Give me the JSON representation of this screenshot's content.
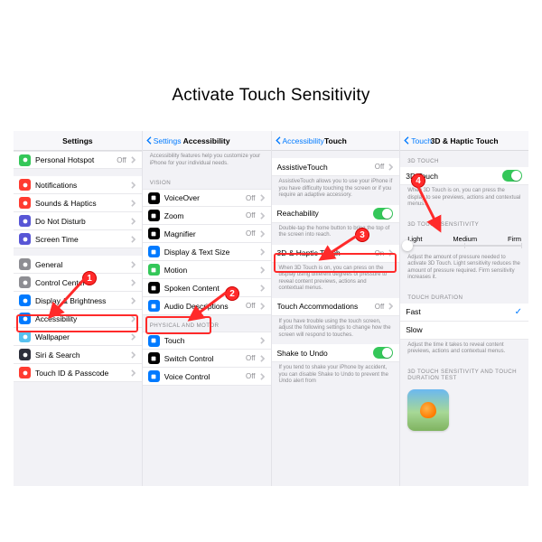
{
  "title": "Activate Touch Sensitivity",
  "panel1": {
    "header": "Settings",
    "rows": [
      {
        "label": "Personal Hotspot",
        "val": "Off",
        "iconColor": "#34c759"
      },
      {
        "label": "Notifications",
        "iconColor": "#ff3b30"
      },
      {
        "label": "Sounds & Haptics",
        "iconColor": "#ff3b30"
      },
      {
        "label": "Do Not Disturb",
        "iconColor": "#5856d6"
      },
      {
        "label": "Screen Time",
        "iconColor": "#5856d6"
      },
      {
        "label": "General",
        "iconColor": "#8e8e93"
      },
      {
        "label": "Control Center",
        "iconColor": "#8e8e93"
      },
      {
        "label": "Display & Brightness",
        "iconColor": "#007aff"
      },
      {
        "label": "Accessibility",
        "iconColor": "#007aff"
      },
      {
        "label": "Wallpaper",
        "iconColor": "#57c1ef"
      },
      {
        "label": "Siri & Search",
        "iconColor": "#2d2f3b"
      },
      {
        "label": "Touch ID & Passcode",
        "iconColor": "#ff3b30"
      }
    ]
  },
  "panel2": {
    "back": "Settings",
    "header": "Accessibility",
    "desc": "Accessibility features help you customize your iPhone for your individual needs.",
    "sect1": "VISION",
    "vision": [
      {
        "label": "VoiceOver",
        "val": "Off",
        "iconColor": "#000"
      },
      {
        "label": "Zoom",
        "val": "Off",
        "iconColor": "#000"
      },
      {
        "label": "Magnifier",
        "val": "Off",
        "iconColor": "#000"
      },
      {
        "label": "Display & Text Size",
        "iconColor": "#007aff"
      },
      {
        "label": "Motion",
        "iconColor": "#34c759"
      },
      {
        "label": "Spoken Content",
        "iconColor": "#000"
      },
      {
        "label": "Audio Descriptions",
        "val": "Off",
        "iconColor": "#007aff"
      }
    ],
    "sect2": "PHYSICAL AND MOTOR",
    "motor": [
      {
        "label": "Touch",
        "iconColor": "#007aff"
      },
      {
        "label": "Switch Control",
        "val": "Off",
        "iconColor": "#000"
      },
      {
        "label": "Voice Control",
        "val": "Off",
        "iconColor": "#007aff"
      }
    ]
  },
  "panel3": {
    "back": "Accessibility",
    "header": "Touch",
    "rows": [
      {
        "label": "AssistiveTouch",
        "val": "Off"
      }
    ],
    "desc1": "AssistiveTouch allows you to use your iPhone if you have difficulty touching the screen or if you require an adaptive accessory.",
    "reach": {
      "label": "Reachability"
    },
    "desc2": "Double-tap the home button to bring the top of the screen into reach.",
    "haptic": {
      "label": "3D & Haptic Touch",
      "val": "On"
    },
    "desc3": "When 3D Touch is on, you can press on the display using different degrees of pressure to reveal content previews, actions and contextual menus.",
    "accom": {
      "label": "Touch Accommodations",
      "val": "Off"
    },
    "desc4": "If you have trouble using the touch screen, adjust the following settings to change how the screen will respond to touches.",
    "shake": {
      "label": "Shake to Undo"
    },
    "desc5": "If you tend to shake your iPhone by accident, you can disable Shake to Undo to prevent the Undo alert from"
  },
  "panel4": {
    "back": "Touch",
    "header": "3D & Haptic Touch",
    "sect1": "3D TOUCH",
    "row1": {
      "label": "3D Touch"
    },
    "desc1": "When 3D Touch is on, you can press the display to see previews, actions and contextual menus.",
    "sect2": "3D TOUCH SENSITIVITY",
    "seg": [
      "Light",
      "Medium",
      "Firm"
    ],
    "desc2": "Adjust the amount of pressure needed to activate 3D Touch. Light sensitivity reduces the amount of pressure required. Firm sensitivity increases it.",
    "sect3": "TOUCH DURATION",
    "dur": [
      {
        "label": "Fast",
        "checked": true
      },
      {
        "label": "Slow",
        "checked": false
      }
    ],
    "desc3": "Adjust the time it takes to reveal content previews, actions and contextual menus.",
    "sect4": "3D TOUCH SENSITIVITY AND TOUCH DURATION TEST"
  },
  "markers": [
    "1",
    "2",
    "3",
    "4"
  ]
}
